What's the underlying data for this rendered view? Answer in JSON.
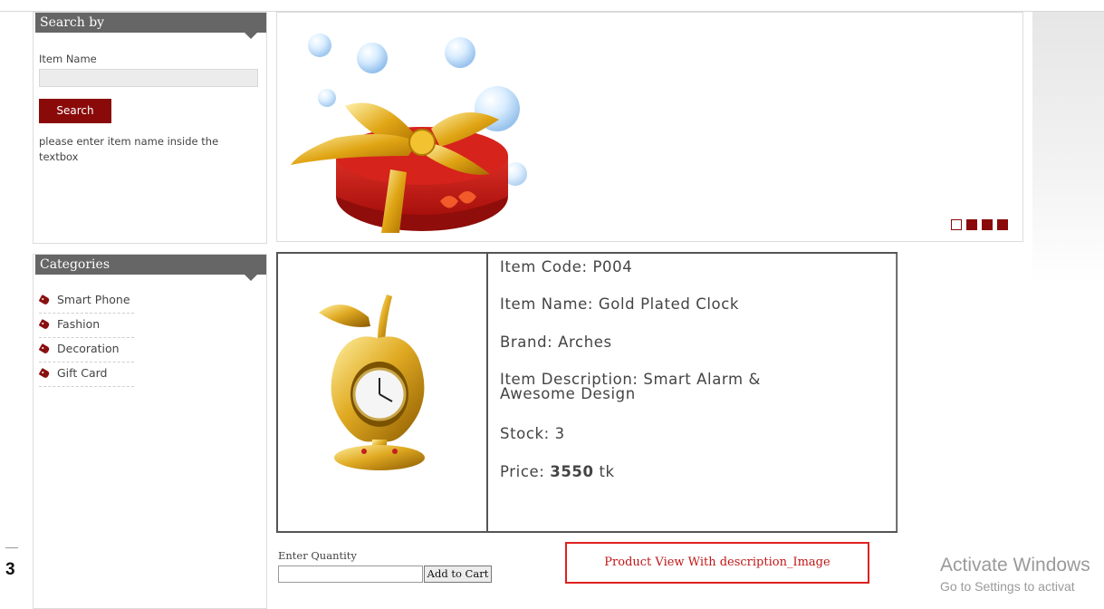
{
  "page_number": "3",
  "search": {
    "header": "Search by",
    "field_label": "Item Name",
    "input_value": "",
    "button_label": "Search",
    "hint": "please enter item name inside the textbox"
  },
  "categories": {
    "header": "Categories",
    "items": [
      "Smart Phone",
      "Fashion",
      "Decoration",
      "Gift Card"
    ]
  },
  "slider": {
    "image": "gift-box-with-bubbles",
    "dots_total": 4,
    "active_dot": 0
  },
  "product": {
    "image": "gold-apple-clock",
    "item_code": "Item Code: P004",
    "item_name": "Item Name: Gold Plated Clock",
    "brand": "Brand: Arches",
    "description_line1": "Item Description: Smart Alarm &",
    "description_line2": "Awesome Design",
    "stock": "Stock: 3",
    "price_label": "Price: ",
    "price_value": "3550",
    "price_unit": " tk"
  },
  "cart": {
    "quantity_label": "Enter Quantity",
    "quantity_value": "",
    "button_label": "Add to Cart"
  },
  "caption": "Product View With description_Image",
  "watermark": {
    "line1": "Activate Windows",
    "line2": "Go to Settings to activat"
  },
  "colors": {
    "accent": "#8a0a0a",
    "header_bg": "#666666",
    "caption_border": "#e02020"
  }
}
